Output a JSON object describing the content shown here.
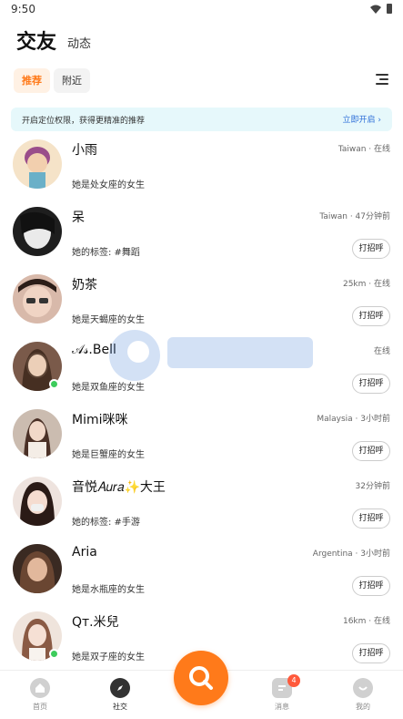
{
  "status": {
    "time": "9:50"
  },
  "header": {
    "tab_active": "交友",
    "tab_other": "动态"
  },
  "filters": {
    "recommend": "推荐",
    "nearby": "附近"
  },
  "banner": {
    "text": "开启定位权限，获得更精准的推荐",
    "link": "立即开启"
  },
  "greet_label": "打招呼",
  "users": [
    {
      "name": "小雨",
      "meta": "Taiwan · 在线",
      "desc": "她是处女座的女生",
      "online": false,
      "avatar_color": "#f5d9b8"
    },
    {
      "name": "呆",
      "meta": "Taiwan · 47分钟前",
      "desc": "她的标签: #舞蹈",
      "online": false,
      "avatar_color": "#2a2a2a"
    },
    {
      "name": "奶茶",
      "meta": "25km · 在线",
      "desc": "她是天蝎座的女生",
      "online": false,
      "avatar_color": "#c9a79a"
    },
    {
      "name": "𝒜𝓈.Bell",
      "meta": "在线",
      "desc": "她是双鱼座的女生",
      "online": true,
      "avatar_color": "#8a6a5a"
    },
    {
      "name": "Mimi咪咪",
      "meta": "Malaysia · 3小时前",
      "desc": "她是巨蟹座的女生",
      "online": false,
      "avatar_color": "#b8a59a"
    },
    {
      "name": "音悦𝐴𝑢𝑟𝑎✨大王",
      "meta": "32分钟前",
      "desc": "她的标签: #手游",
      "online": false,
      "avatar_color": "#d9c4bd"
    },
    {
      "name": "Aria",
      "meta": "Argentina · 3小时前",
      "desc": "她是水瓶座的女生",
      "online": false,
      "avatar_color": "#5a3f30"
    },
    {
      "name": "Qт.米兒",
      "meta": "16km · 在线",
      "desc": "她是双子座的女生",
      "online": true,
      "avatar_color": "#e8cfc2"
    }
  ],
  "nav": {
    "home": "首页",
    "social": "社交",
    "messages": "消息",
    "messages_badge": "4",
    "mine": "我的"
  },
  "colors": {
    "accent": "#ff7a1a",
    "online": "#3dcc5c",
    "link": "#2e6fd8",
    "banner_bg": "#e6f8fb"
  }
}
